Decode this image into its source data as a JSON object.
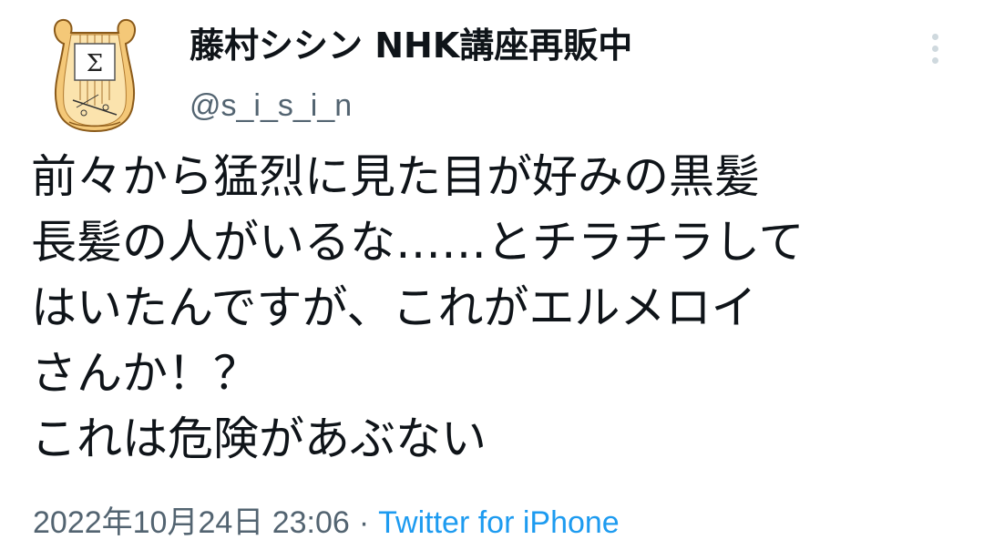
{
  "author": {
    "display_name": "藤村シシン NHK講座再販中",
    "handle": "@s_i_s_i_n",
    "avatar_icon": "lyre-sigma-icon"
  },
  "tweet": {
    "lines": [
      "前々から猛烈に見た目が好みの黒髪",
      "長髪の人がいるな……とチラチラして",
      "はいたんですが、これがエルメロイ",
      "さんか！？",
      "これは危険があぶない"
    ]
  },
  "meta": {
    "timestamp": "2022年10月24日 23:06",
    "separator": "·",
    "source": "Twitter for iPhone"
  },
  "colors": {
    "text": "#0f1419",
    "secondary": "#536471",
    "link": "#1d9bf0",
    "more_dots": "#cfd9de"
  },
  "more_menu_icon": "more-dots-icon"
}
